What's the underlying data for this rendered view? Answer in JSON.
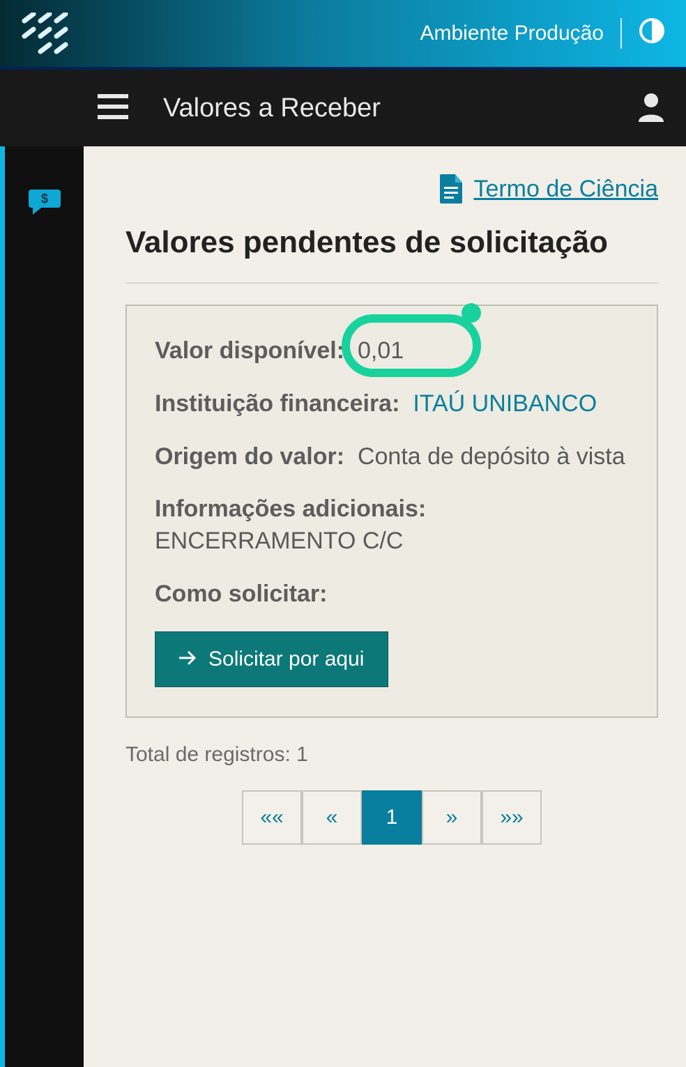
{
  "top": {
    "env_label": "Ambiente Produção"
  },
  "nav": {
    "title": "Valores a Receber"
  },
  "main": {
    "termo_link": "Termo de Ciência",
    "section_title": "Valores pendentes de solicitação",
    "card": {
      "valor_disponivel_label": "Valor disponível:",
      "valor_disponivel_value": "0,01",
      "instituicao_label": "Instituição financeira:",
      "instituicao_value": "ITAÚ UNIBANCO",
      "origem_label": "Origem do valor:",
      "origem_value": "Conta de depósito à vista",
      "info_label": "Informações adicionais:",
      "info_value": "ENCERRAMENTO C/C",
      "cta_label": "Como solicitar:",
      "cta_button": "Solicitar por aqui"
    },
    "total_label": "Total de registros:",
    "total_value": "1",
    "pager": {
      "first": "««",
      "prev": "«",
      "page": "1",
      "next": "»",
      "last": "»»"
    }
  }
}
